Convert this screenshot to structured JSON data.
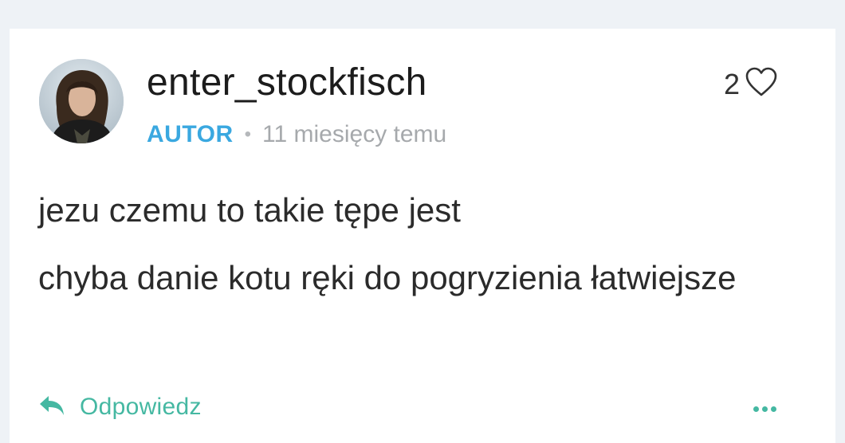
{
  "comment": {
    "username": "enter_stockfisch",
    "badge": "AUTOR",
    "separator": "•",
    "time": "11 miesięcy temu",
    "likes": "2",
    "paragraphs": [
      "jezu czemu to takie tępe jest",
      "chyba danie kotu ręki do pogryzienia łatwiejsze"
    ],
    "reply_label": "Odpowiedz"
  },
  "icons": {
    "like": "heart-icon",
    "reply": "reply-arrow-icon",
    "more": "more-options-icon"
  },
  "colors": {
    "author_badge": "#3aa8e0",
    "accent": "#45b8a2",
    "background": "#eef2f6"
  }
}
